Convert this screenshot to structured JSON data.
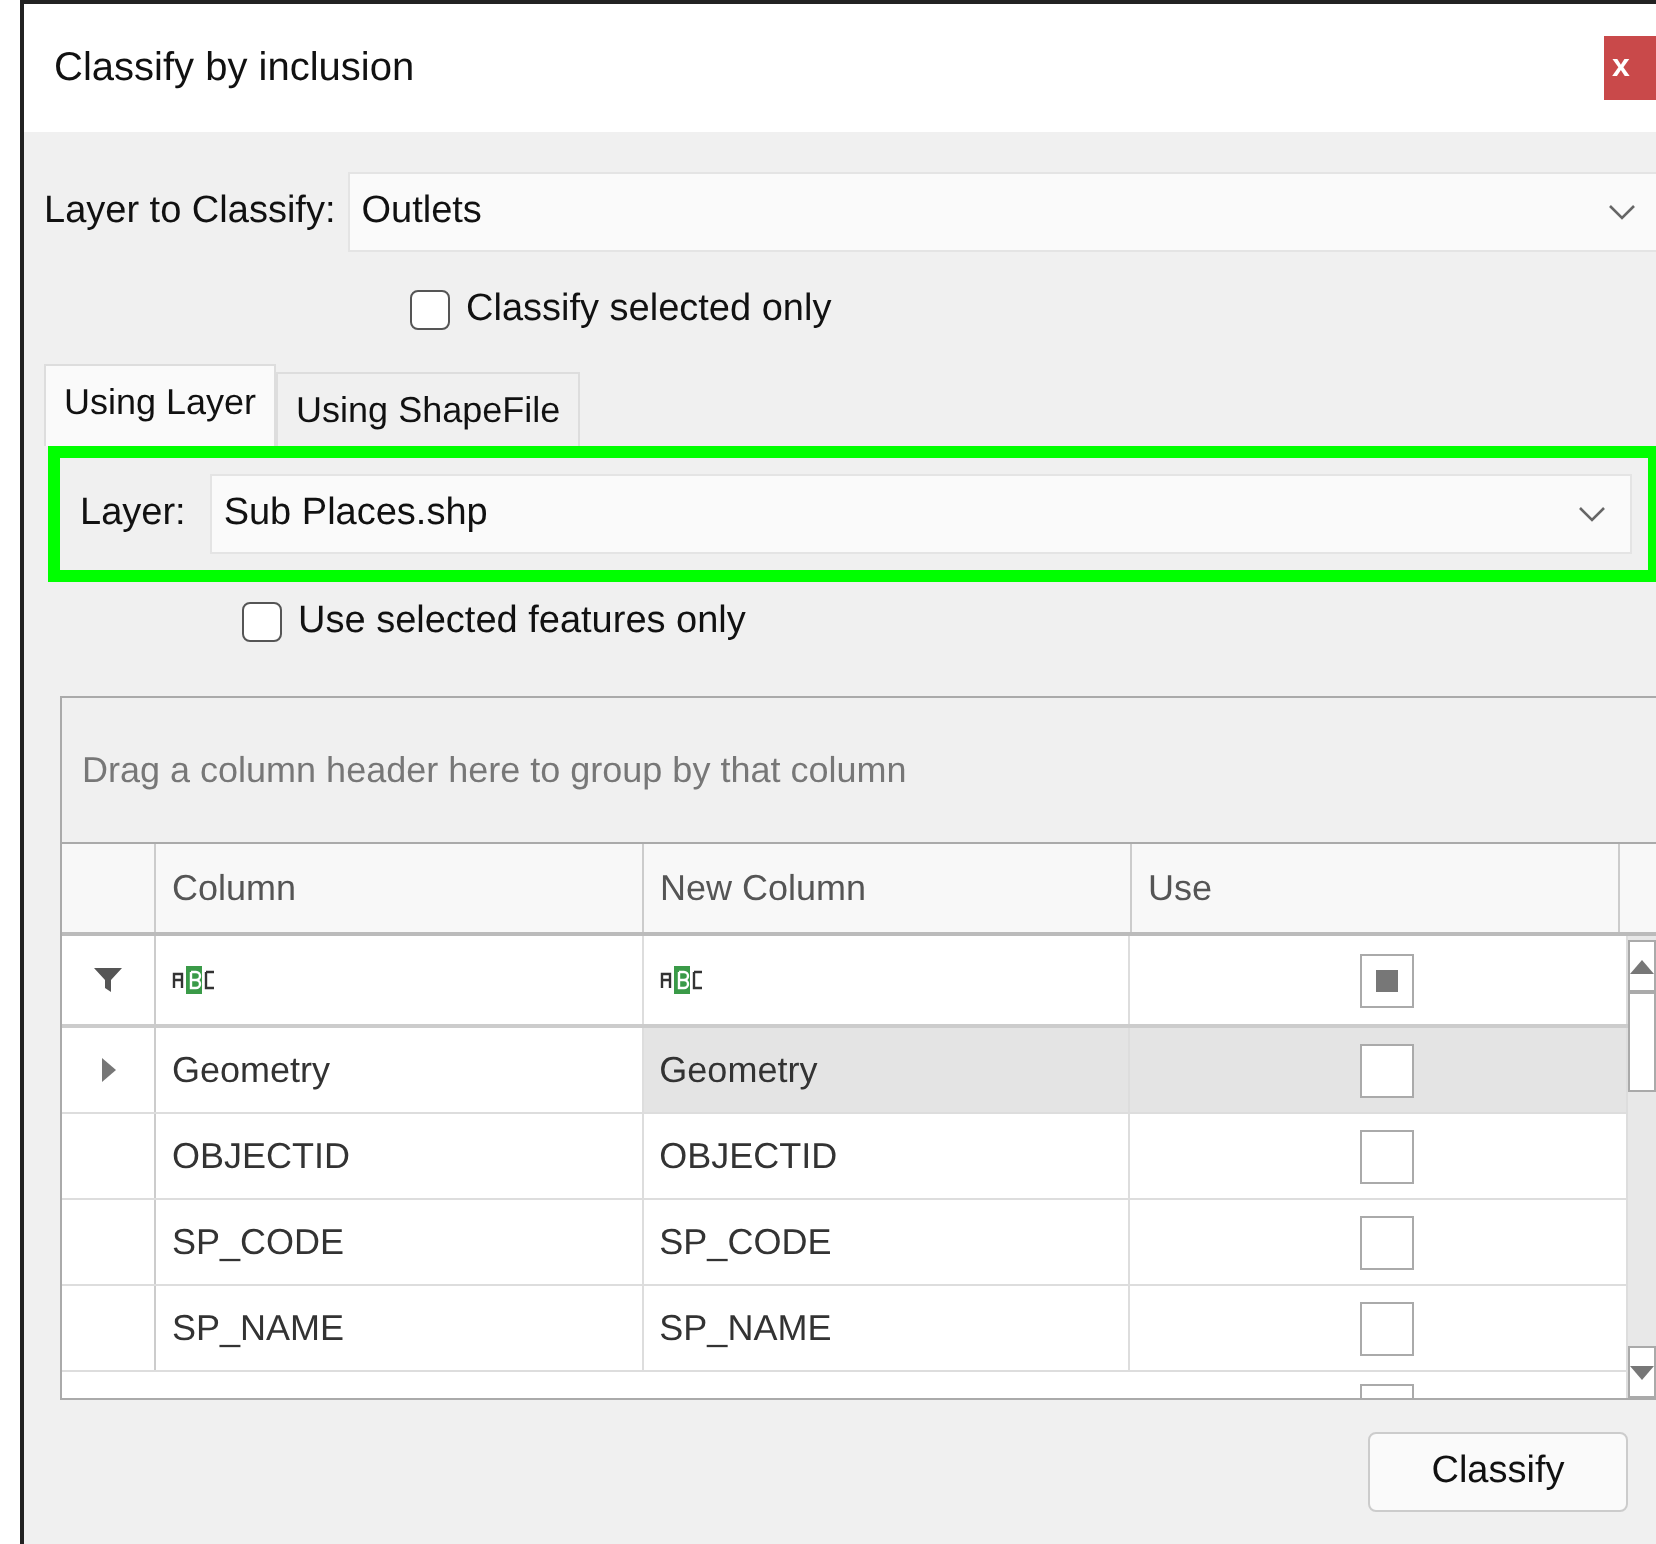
{
  "window": {
    "title": "Classify by inclusion",
    "close": "x"
  },
  "layer_to_classify": {
    "label": "Layer to Classify:",
    "value": "Outlets"
  },
  "classify_selected_only": {
    "label": "Classify selected only",
    "checked": false
  },
  "tabs": [
    {
      "label": "Using Layer",
      "selected": true
    },
    {
      "label": "Using ShapeFile",
      "selected": false
    }
  ],
  "layer": {
    "label": "Layer:",
    "value": "Sub Places.shp",
    "highlighted": true
  },
  "use_selected_features_only": {
    "label": "Use selected features only",
    "checked": false
  },
  "grid": {
    "group_panel": "Drag a column header here to group by that column",
    "columns": [
      "Column",
      "New Column",
      "Use"
    ],
    "filter_use_indeterminate": true,
    "cut_off_row_use": false,
    "rows": [
      {
        "column": "Geometry",
        "new_column": "Geometry",
        "use": false,
        "selected": true
      },
      {
        "column": "OBJECTID",
        "new_column": "OBJECTID",
        "use": false,
        "selected": false
      },
      {
        "column": "SP_CODE",
        "new_column": "SP_CODE",
        "use": false,
        "selected": false
      },
      {
        "column": "SP_NAME",
        "new_column": "SP_NAME",
        "use": false,
        "selected": false
      }
    ]
  },
  "buttons": [
    "Classify"
  ]
}
